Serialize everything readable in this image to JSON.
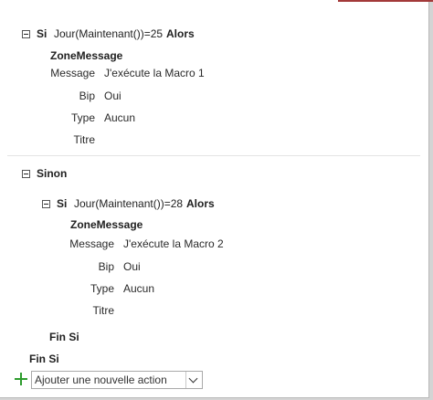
{
  "outer_if": {
    "keyword": "Si",
    "condition": "Jour(Maintenant())=25",
    "then_keyword": "Alors",
    "action": {
      "name": "ZoneMessage",
      "args": [
        {
          "label": "Message",
          "value": "J'exécute la Macro 1"
        },
        {
          "label": "Bip",
          "value": "Oui"
        },
        {
          "label": "Type",
          "value": "Aucun"
        },
        {
          "label": "Titre",
          "value": ""
        }
      ]
    }
  },
  "else_block": {
    "keyword": "Sinon",
    "inner_if": {
      "keyword": "Si",
      "condition": "Jour(Maintenant())=28",
      "then_keyword": "Alors",
      "action": {
        "name": "ZoneMessage",
        "args": [
          {
            "label": "Message",
            "value": "J'exécute la Macro 2"
          },
          {
            "label": "Bip",
            "value": "Oui"
          },
          {
            "label": "Type",
            "value": "Aucun"
          },
          {
            "label": "Titre",
            "value": ""
          }
        ]
      },
      "end_keyword": "Fin Si"
    }
  },
  "outer_end_keyword": "Fin Si",
  "add_action": {
    "placeholder": "Ajouter une nouvelle action"
  },
  "colors": {
    "add_icon": "#2e9c2e",
    "top_accent": "#a33a3a"
  }
}
